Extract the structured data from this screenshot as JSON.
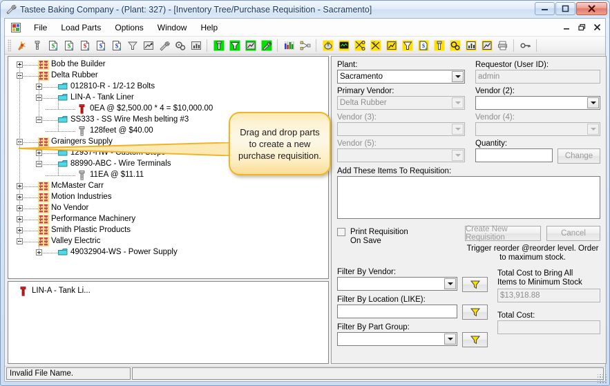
{
  "window": {
    "title": "Tastee Baking Company - (Plant: 327) - [Inventory Tree/Purchase Requisition - Sacramento]",
    "title_icon": "wrench-icon",
    "minimize_label": "–",
    "maximize_label": "❐",
    "close_label": "✕"
  },
  "child_window": {
    "minimize_label": "–",
    "restore_label": "❐",
    "close_label": "✕"
  },
  "menu": {
    "app_icon": "app-icon",
    "items": [
      {
        "label": "File",
        "name": "menu-file"
      },
      {
        "label": "Load Parts",
        "name": "menu-load-parts"
      },
      {
        "label": "Options",
        "name": "menu-options"
      },
      {
        "label": "Window",
        "name": "menu-window"
      },
      {
        "label": "Help",
        "name": "menu-help"
      }
    ]
  },
  "toolbar": {
    "buttons": [
      {
        "name": "fireworks-icon"
      },
      {
        "name": "bolt-part-icon"
      },
      {
        "name": "document-dollar-green-icon"
      },
      {
        "name": "document-dollar-green2-icon"
      },
      {
        "name": "document-dollar-red-icon"
      },
      {
        "name": "document-dollar-blue-icon"
      },
      {
        "name": "document-dollar-blue2-icon"
      },
      {
        "name": "funnel-grey-icon"
      },
      {
        "name": "chart-up-icon"
      },
      {
        "name": "wrench-icon"
      },
      {
        "name": "gears-icon"
      },
      {
        "name": "chart-bars-icon"
      },
      {
        "name": "sep"
      },
      {
        "name": "bolt-part-green-icon"
      },
      {
        "name": "funnel-green-icon"
      },
      {
        "name": "chart-up-green-icon"
      },
      {
        "name": "wrench-green-icon"
      },
      {
        "name": "sep"
      },
      {
        "name": "equalizer-icon"
      },
      {
        "name": "network-nodes-icon"
      },
      {
        "name": "sep"
      },
      {
        "name": "mouse-yellow-icon"
      },
      {
        "name": "monitor-yellow-icon"
      },
      {
        "name": "scissors-yellow-icon"
      },
      {
        "name": "scissors2-yellow-icon"
      },
      {
        "name": "chart-up-yellow-icon"
      },
      {
        "name": "funnel-yellow-icon"
      },
      {
        "name": "document-dollar-yellow-icon"
      },
      {
        "name": "bolt-part-yellow-icon"
      },
      {
        "name": "gears-yellow-icon"
      },
      {
        "name": "chart-bars-yellow-icon"
      },
      {
        "name": "chart-bars2-yellow-icon"
      },
      {
        "name": "printer-icon"
      },
      {
        "name": "sep"
      },
      {
        "name": "key-icon"
      },
      {
        "name": "sep"
      }
    ]
  },
  "tree": {
    "nodes": [
      {
        "label": "Bob the Builder",
        "depth": 0,
        "toggle": "plus",
        "icon": "vendor-icon"
      },
      {
        "label": "Delta Rubber",
        "depth": 0,
        "toggle": "minus",
        "icon": "vendor-icon"
      },
      {
        "label": "012810-R - 1/2-12 Bolts",
        "depth": 1,
        "toggle": "plus",
        "icon": "part-icon"
      },
      {
        "label": "LIN-A - Tank Liner",
        "depth": 1,
        "toggle": "minus",
        "icon": "part-icon"
      },
      {
        "label": "0EA @ $2,500.00 * 4 = $10,000.00",
        "depth": 2,
        "toggle": "none",
        "icon": "bolt-red-icon"
      },
      {
        "label": "SS333 - SS Wire Mesh belting #3",
        "depth": 1,
        "toggle": "minus",
        "icon": "part-icon"
      },
      {
        "label": "128feet @ $40.00",
        "depth": 2,
        "toggle": "none",
        "icon": "bolt-grey-icon"
      },
      {
        "label": "Graingers Supply",
        "depth": 0,
        "toggle": "minus",
        "icon": "vendor-icon"
      },
      {
        "label": "12937-HW - Custom Steps",
        "depth": 1,
        "toggle": "plus",
        "icon": "part-icon"
      },
      {
        "label": "88990-ABC - Wire Terminals",
        "depth": 1,
        "toggle": "minus",
        "icon": "part-icon"
      },
      {
        "label": "11EA @ $11.11",
        "depth": 2,
        "toggle": "none",
        "icon": "bolt-grey-icon"
      },
      {
        "label": "McMaster Carr",
        "depth": 0,
        "toggle": "plus",
        "icon": "vendor-icon"
      },
      {
        "label": "Motion Industries",
        "depth": 0,
        "toggle": "plus",
        "icon": "vendor-icon"
      },
      {
        "label": "No Vendor",
        "depth": 0,
        "toggle": "plus",
        "icon": "vendor-icon"
      },
      {
        "label": "Performance Machinery",
        "depth": 0,
        "toggle": "plus",
        "icon": "vendor-icon"
      },
      {
        "label": "Smith Plastic Products",
        "depth": 0,
        "toggle": "plus",
        "icon": "vendor-icon"
      },
      {
        "label": "Valley Electric",
        "depth": 0,
        "toggle": "minus",
        "icon": "vendor-icon"
      },
      {
        "label": "49032904-WS - Power Supply",
        "depth": 1,
        "toggle": "plus",
        "icon": "part-icon"
      }
    ]
  },
  "callout": {
    "text": "Drag and drop parts to create a new purchase requisition.",
    "border_color": "#f0b429",
    "fill_color": "#fdf3d6"
  },
  "basket": {
    "items": [
      {
        "label": "LIN-A - Tank Li...",
        "icon": "bolt-red-icon"
      }
    ]
  },
  "form": {
    "plant": {
      "label": "Plant:",
      "value": "Sacramento"
    },
    "requestor": {
      "label": "Requestor (User ID):",
      "value": "admin"
    },
    "primary_vendor": {
      "label": "Primary Vendor:",
      "value": "Delta Rubber"
    },
    "vendor2": {
      "label": "Vendor (2):",
      "value": ""
    },
    "vendor3": {
      "label": "Vendor (3):",
      "value": ""
    },
    "vendor4": {
      "label": "Vendor (4):",
      "value": ""
    },
    "vendor5": {
      "label": "Vendor (5):",
      "value": ""
    },
    "quantity": {
      "label": "Quantity:",
      "value": ""
    },
    "change_button": "Change",
    "add_items": {
      "label": "Add These Items To Requisition:",
      "value": ""
    },
    "print_requisition_checkbox": "Print Requisition\nOn Save",
    "print_requisition_line1": "Print Requisition",
    "print_requisition_line2": "On Save",
    "create_button": "Create New Requisition",
    "cancel_button": "Cancel",
    "reorder_hint": "Trigger reorder @reorder level. Order to maximum stock.",
    "filter_by_vendor": {
      "label": "Filter By Vendor:",
      "value": ""
    },
    "filter_by_location": {
      "label": "Filter By Location (LIKE):",
      "value": ""
    },
    "filter_by_part_group": {
      "label": "Filter By Part Group:",
      "value": ""
    },
    "total_min_stock": {
      "label_line1": "Total Cost to Bring All",
      "label_line2": "Items to Minimum Stock",
      "value": "$13,918.88"
    },
    "total_cost": {
      "label": "Total Cost:",
      "value": ""
    },
    "filter_icon": "funnel-yellow-icon"
  },
  "statusbar": {
    "message": "Invalid File Name.",
    "secondary": ""
  }
}
